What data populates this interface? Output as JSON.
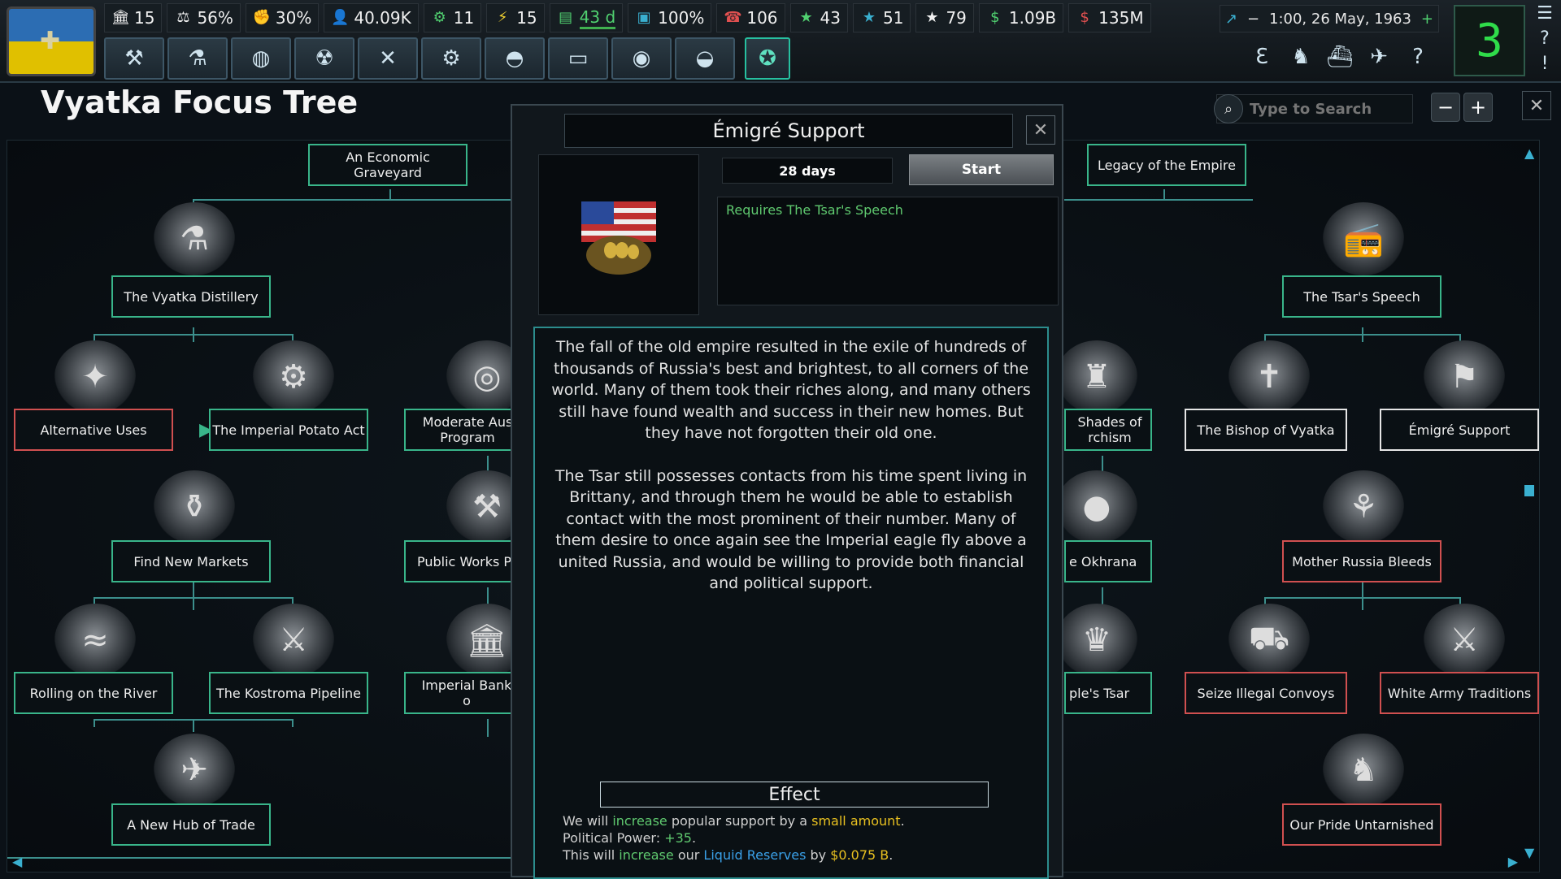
{
  "topbar": {
    "stats": [
      {
        "icon": "building-icon",
        "value": "15"
      },
      {
        "icon": "scales-icon",
        "value": "56%"
      },
      {
        "icon": "fist-icon",
        "value": "30%"
      },
      {
        "icon": "manpower-icon",
        "value": "40.09K"
      },
      {
        "icon": "gear-icon",
        "value": "11"
      },
      {
        "icon": "lightning-icon",
        "value": "15"
      },
      {
        "icon": "money-stack-icon",
        "value": "43 d"
      },
      {
        "icon": "monitor-icon",
        "value": "100%"
      },
      {
        "icon": "phone-icon",
        "value": "106"
      },
      {
        "icon": "star-icon",
        "value": "43"
      },
      {
        "icon": "star-icon",
        "value": "51"
      },
      {
        "icon": "star-icon",
        "value": "79"
      },
      {
        "icon": "dollar-icon",
        "value": "1.09B"
      },
      {
        "icon": "dollar-red-icon",
        "value": "135M"
      }
    ],
    "date": "1:00, 26 May, 1963",
    "speed": "3"
  },
  "header": {
    "title": "Vyatka Focus Tree",
    "search_placeholder": "Type to Search"
  },
  "tree": {
    "nodes": {
      "economic_graveyard": "An Economic Graveyard",
      "vyatka_distillery": "The Vyatka Distillery",
      "alternative_uses": "Alternative Uses",
      "imperial_potato": "The Imperial Potato Act",
      "moderate_aus": "Moderate Aus Program",
      "find_new_markets": "Find New Markets",
      "public_works": "Public Works P",
      "rolling_river": "Rolling on the River",
      "kostroma_pipeline": "The Kostroma Pipeline",
      "imperial_bank": "Imperial Bank o",
      "new_hub_trade": "A New Hub of Trade",
      "legacy_empire": "Legacy of the Empire",
      "tsars_speech": "The Tsar's Speech",
      "shades": "Shades of rchism",
      "bishop_vyatka": "The Bishop of Vyatka",
      "emigre_support": "Émigré Support",
      "okhrana": "e Okhrana",
      "mother_russia": "Mother Russia Bleeds",
      "peoples_tsar": "ple's Tsar",
      "seize_convoys": "Seize Illegal Convoys",
      "white_army": "White Army Traditions",
      "our_pride": "Our Pride Untarnished"
    }
  },
  "modal": {
    "title": "Émigré Support",
    "days": "28 days",
    "start_label": "Start",
    "requirement": "Requires The Tsar's Speech",
    "description_1": "The fall of the old empire resulted in the exile of hundreds of thousands of Russia's best and brightest, to all corners of the world. Many of them took their riches along, and many others still have found wealth and success in their new homes. But they have not forgotten their old one.",
    "description_2": "The Tsar still possesses contacts from his time spent living in Brittany, and through them he would be able to establish contact with the most prominent of their number. Many of them desire to once again see the Imperial eagle fly above a united Russia, and would be willing to provide both financial and political support.",
    "effect_title": "Effect",
    "effect_line1": {
      "a": "We will ",
      "b": "increase",
      "c": " popular support by a ",
      "d": "small amount",
      "e": "."
    },
    "effect_line2": {
      "a": "Political Power: ",
      "b": "+35",
      "c": "."
    },
    "effect_line3": {
      "a": "This will ",
      "b": "increase",
      "c": " our ",
      "d": "Liquid Reserves",
      "e": " by ",
      "f": "$0.075 B",
      "g": "."
    }
  }
}
